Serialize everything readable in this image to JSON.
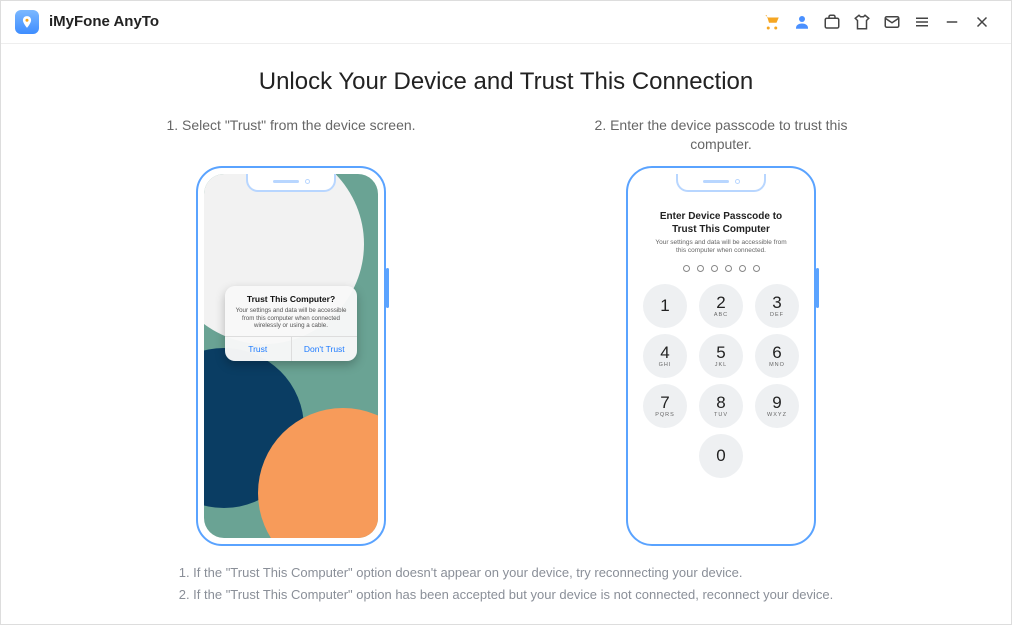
{
  "app": {
    "title": "iMyFone AnyTo"
  },
  "page": {
    "heading": "Unlock Your Device and Trust This Connection",
    "step1": "1. Select \"Trust\" from the device screen.",
    "step2": "2. Enter the device passcode to trust this computer.",
    "note1": "1. If the \"Trust This Computer\" option doesn't appear on your device, try reconnecting your device.",
    "note2": "2. If the \"Trust This Computer\" option has been accepted but your device is not connected, reconnect your device."
  },
  "trust_dialog": {
    "title": "Trust This Computer?",
    "body": "Your settings and data will be accessible from this computer when connected wirelessly or using a cable.",
    "trust": "Trust",
    "dont_trust": "Don't Trust"
  },
  "passcode": {
    "title": "Enter Device Passcode to Trust This Computer",
    "sub": "Your settings and data will be accessible from this computer when connected.",
    "keys": {
      "k1n": "1",
      "k1l": "",
      "k2n": "2",
      "k2l": "ABC",
      "k3n": "3",
      "k3l": "DEF",
      "k4n": "4",
      "k4l": "GHI",
      "k5n": "5",
      "k5l": "JKL",
      "k6n": "6",
      "k6l": "MNO",
      "k7n": "7",
      "k7l": "PQRS",
      "k8n": "8",
      "k8l": "TUV",
      "k9n": "9",
      "k9l": "WXYZ",
      "k0n": "0",
      "k0l": ""
    }
  }
}
